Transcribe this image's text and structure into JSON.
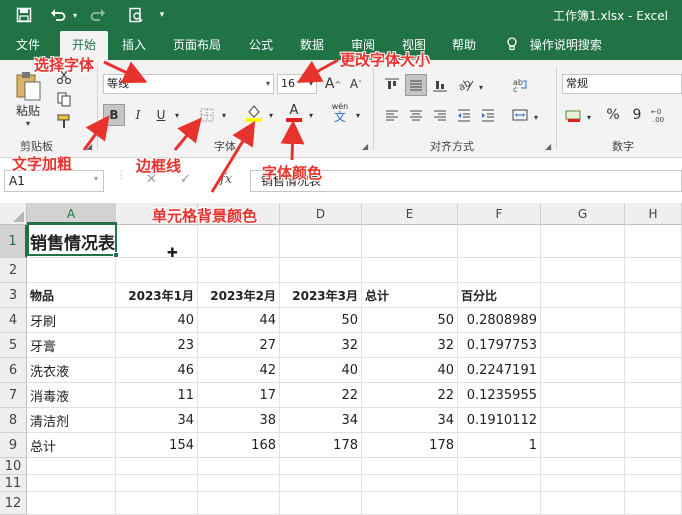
{
  "titlebar": {
    "title": "工作簿1.xlsx  -  Excel",
    "save_icon": "save-icon",
    "undo_icon": "undo-icon",
    "redo_icon": "redo-icon",
    "preview_icon": "print-preview-icon"
  },
  "tabs": [
    {
      "label": "文件"
    },
    {
      "label": "开始"
    },
    {
      "label": "插入"
    },
    {
      "label": "页面布局"
    },
    {
      "label": "公式"
    },
    {
      "label": "数据"
    },
    {
      "label": "审阅"
    },
    {
      "label": "视图"
    },
    {
      "label": "帮助"
    },
    {
      "label": "操作说明搜索"
    }
  ],
  "ribbon": {
    "clipboard_label": "剪贴板",
    "paste_label": "粘贴",
    "font_group_label": "字体",
    "align_group_label": "对齐方式",
    "number_group_label": "数字",
    "font_name": "等线",
    "font_size": "16",
    "number_format": "常规",
    "bold_label": "B",
    "italic_label": "I",
    "underline_label": "U",
    "font_color_label": "A",
    "wen_label": "wén",
    "percent_label": "%",
    "comma_label": "9"
  },
  "formula_bar": {
    "name_box": "A1",
    "fx_label": "fx",
    "content": "销售情况表"
  },
  "grid": {
    "columns": [
      "A",
      "B",
      "C",
      "D",
      "E",
      "F",
      "G",
      "H"
    ],
    "rows": [
      "1",
      "2",
      "3",
      "4",
      "5",
      "6",
      "7",
      "8",
      "9",
      "10",
      "11",
      "12"
    ],
    "title": "销售情况表",
    "header": [
      "物品",
      "2023年1月",
      "2023年2月",
      "2023年3月",
      "总计",
      "百分比"
    ],
    "data": [
      [
        "牙刷",
        "40",
        "44",
        "50",
        "50",
        "0.2808989"
      ],
      [
        "牙膏",
        "23",
        "27",
        "32",
        "32",
        "0.1797753"
      ],
      [
        "洗衣液",
        "46",
        "42",
        "40",
        "40",
        "0.2247191"
      ],
      [
        "消毒液",
        "11",
        "17",
        "22",
        "22",
        "0.1235955"
      ],
      [
        "清洁剂",
        "34",
        "38",
        "34",
        "34",
        "0.1910112"
      ],
      [
        "总计",
        "154",
        "168",
        "178",
        "178",
        "1"
      ]
    ]
  },
  "annotations": {
    "choose_font": "选择字体",
    "change_size": "更改字体大小",
    "bold_text": "文字加粗",
    "border": "边框线",
    "fill_color": "单元格背景颜色",
    "font_color": "字体颜色"
  },
  "colors": {
    "excel_green": "#217346",
    "annotation_red": "#e8322d",
    "font_color_bar": "#e02020",
    "fill_color_bar": "#ffff00"
  }
}
